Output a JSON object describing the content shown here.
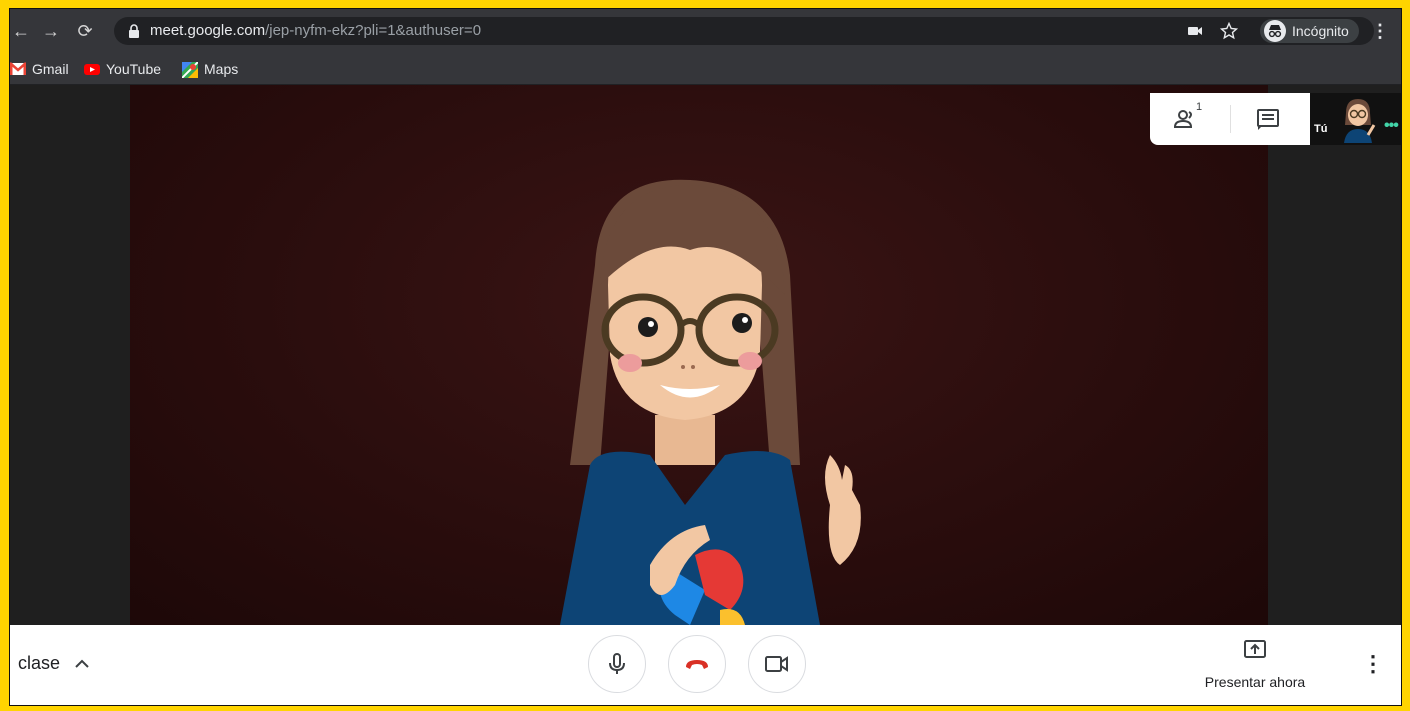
{
  "browser": {
    "url_host": "meet.google.com",
    "url_path": "/jep-nyfm-ekz?pli=1&authuser=0",
    "incognito_label": "Incógnito",
    "icons": [
      "back-icon",
      "forward-icon",
      "reload-icon",
      "lock-icon",
      "camera-icon",
      "star-icon",
      "incognito-icon",
      "kebab-menu-icon"
    ]
  },
  "bookmarks": [
    {
      "label": "Gmail",
      "icon": "gmail-icon"
    },
    {
      "label": "YouTube",
      "icon": "youtube-icon"
    },
    {
      "label": "Maps",
      "icon": "maps-icon"
    }
  ],
  "meet": {
    "participants_count": "1",
    "self_label": "Tú",
    "meeting_name": "clase",
    "present_label": "Presentar ahora",
    "colors": {
      "hangup": "#d93025",
      "accent_dots": "#42d4a8"
    }
  }
}
